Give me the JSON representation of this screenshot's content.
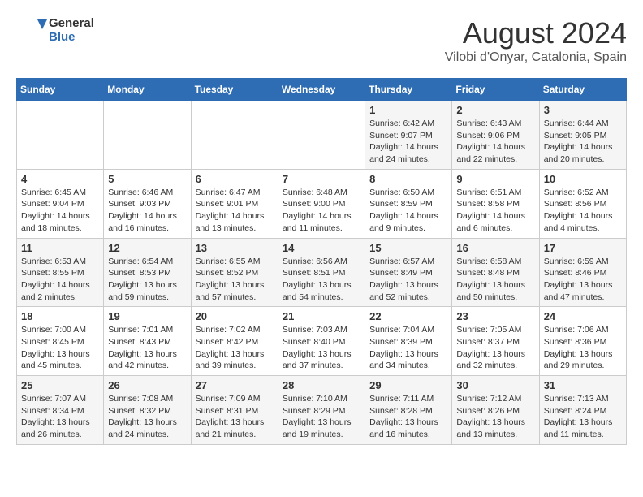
{
  "header": {
    "logo_line1": "General",
    "logo_line2": "Blue",
    "month_title": "August 2024",
    "subtitle": "Vilobi d'Onyar, Catalonia, Spain"
  },
  "days_of_week": [
    "Sunday",
    "Monday",
    "Tuesday",
    "Wednesday",
    "Thursday",
    "Friday",
    "Saturday"
  ],
  "weeks": [
    [
      {
        "day": "",
        "info": ""
      },
      {
        "day": "",
        "info": ""
      },
      {
        "day": "",
        "info": ""
      },
      {
        "day": "",
        "info": ""
      },
      {
        "day": "1",
        "info": "Sunrise: 6:42 AM\nSunset: 9:07 PM\nDaylight: 14 hours and 24 minutes."
      },
      {
        "day": "2",
        "info": "Sunrise: 6:43 AM\nSunset: 9:06 PM\nDaylight: 14 hours and 22 minutes."
      },
      {
        "day": "3",
        "info": "Sunrise: 6:44 AM\nSunset: 9:05 PM\nDaylight: 14 hours and 20 minutes."
      }
    ],
    [
      {
        "day": "4",
        "info": "Sunrise: 6:45 AM\nSunset: 9:04 PM\nDaylight: 14 hours and 18 minutes."
      },
      {
        "day": "5",
        "info": "Sunrise: 6:46 AM\nSunset: 9:03 PM\nDaylight: 14 hours and 16 minutes."
      },
      {
        "day": "6",
        "info": "Sunrise: 6:47 AM\nSunset: 9:01 PM\nDaylight: 14 hours and 13 minutes."
      },
      {
        "day": "7",
        "info": "Sunrise: 6:48 AM\nSunset: 9:00 PM\nDaylight: 14 hours and 11 minutes."
      },
      {
        "day": "8",
        "info": "Sunrise: 6:50 AM\nSunset: 8:59 PM\nDaylight: 14 hours and 9 minutes."
      },
      {
        "day": "9",
        "info": "Sunrise: 6:51 AM\nSunset: 8:58 PM\nDaylight: 14 hours and 6 minutes."
      },
      {
        "day": "10",
        "info": "Sunrise: 6:52 AM\nSunset: 8:56 PM\nDaylight: 14 hours and 4 minutes."
      }
    ],
    [
      {
        "day": "11",
        "info": "Sunrise: 6:53 AM\nSunset: 8:55 PM\nDaylight: 14 hours and 2 minutes."
      },
      {
        "day": "12",
        "info": "Sunrise: 6:54 AM\nSunset: 8:53 PM\nDaylight: 13 hours and 59 minutes."
      },
      {
        "day": "13",
        "info": "Sunrise: 6:55 AM\nSunset: 8:52 PM\nDaylight: 13 hours and 57 minutes."
      },
      {
        "day": "14",
        "info": "Sunrise: 6:56 AM\nSunset: 8:51 PM\nDaylight: 13 hours and 54 minutes."
      },
      {
        "day": "15",
        "info": "Sunrise: 6:57 AM\nSunset: 8:49 PM\nDaylight: 13 hours and 52 minutes."
      },
      {
        "day": "16",
        "info": "Sunrise: 6:58 AM\nSunset: 8:48 PM\nDaylight: 13 hours and 50 minutes."
      },
      {
        "day": "17",
        "info": "Sunrise: 6:59 AM\nSunset: 8:46 PM\nDaylight: 13 hours and 47 minutes."
      }
    ],
    [
      {
        "day": "18",
        "info": "Sunrise: 7:00 AM\nSunset: 8:45 PM\nDaylight: 13 hours and 45 minutes."
      },
      {
        "day": "19",
        "info": "Sunrise: 7:01 AM\nSunset: 8:43 PM\nDaylight: 13 hours and 42 minutes."
      },
      {
        "day": "20",
        "info": "Sunrise: 7:02 AM\nSunset: 8:42 PM\nDaylight: 13 hours and 39 minutes."
      },
      {
        "day": "21",
        "info": "Sunrise: 7:03 AM\nSunset: 8:40 PM\nDaylight: 13 hours and 37 minutes."
      },
      {
        "day": "22",
        "info": "Sunrise: 7:04 AM\nSunset: 8:39 PM\nDaylight: 13 hours and 34 minutes."
      },
      {
        "day": "23",
        "info": "Sunrise: 7:05 AM\nSunset: 8:37 PM\nDaylight: 13 hours and 32 minutes."
      },
      {
        "day": "24",
        "info": "Sunrise: 7:06 AM\nSunset: 8:36 PM\nDaylight: 13 hours and 29 minutes."
      }
    ],
    [
      {
        "day": "25",
        "info": "Sunrise: 7:07 AM\nSunset: 8:34 PM\nDaylight: 13 hours and 26 minutes."
      },
      {
        "day": "26",
        "info": "Sunrise: 7:08 AM\nSunset: 8:32 PM\nDaylight: 13 hours and 24 minutes."
      },
      {
        "day": "27",
        "info": "Sunrise: 7:09 AM\nSunset: 8:31 PM\nDaylight: 13 hours and 21 minutes."
      },
      {
        "day": "28",
        "info": "Sunrise: 7:10 AM\nSunset: 8:29 PM\nDaylight: 13 hours and 19 minutes."
      },
      {
        "day": "29",
        "info": "Sunrise: 7:11 AM\nSunset: 8:28 PM\nDaylight: 13 hours and 16 minutes."
      },
      {
        "day": "30",
        "info": "Sunrise: 7:12 AM\nSunset: 8:26 PM\nDaylight: 13 hours and 13 minutes."
      },
      {
        "day": "31",
        "info": "Sunrise: 7:13 AM\nSunset: 8:24 PM\nDaylight: 13 hours and 11 minutes."
      }
    ]
  ]
}
